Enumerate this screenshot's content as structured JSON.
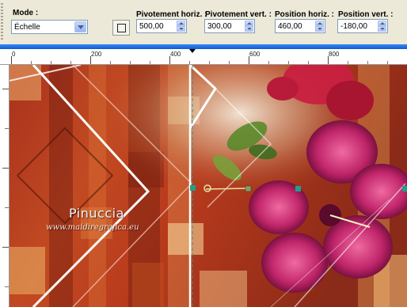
{
  "toolbar": {
    "mode_label": "Mode :",
    "mode_value": "Échelle",
    "pivot_h_label": "Pivotement horiz. :",
    "pivot_h_value": "500,00",
    "pivot_v_label": "Pivotement vert. :",
    "pivot_v_value": "300,00",
    "pos_h_label": "Position horiz. :",
    "pos_h_value": "460,00",
    "pos_v_label": "Position vert. :",
    "pos_v_value": "-180,00"
  },
  "ruler": {
    "labels": [
      "0",
      "200",
      "400",
      "600",
      "800"
    ]
  },
  "watermark": {
    "name": "Pinuccia",
    "site": "www.maidiregrafica.eu"
  },
  "colors": {
    "accent": "#0a5ad8",
    "handle": "#1fa08c"
  }
}
